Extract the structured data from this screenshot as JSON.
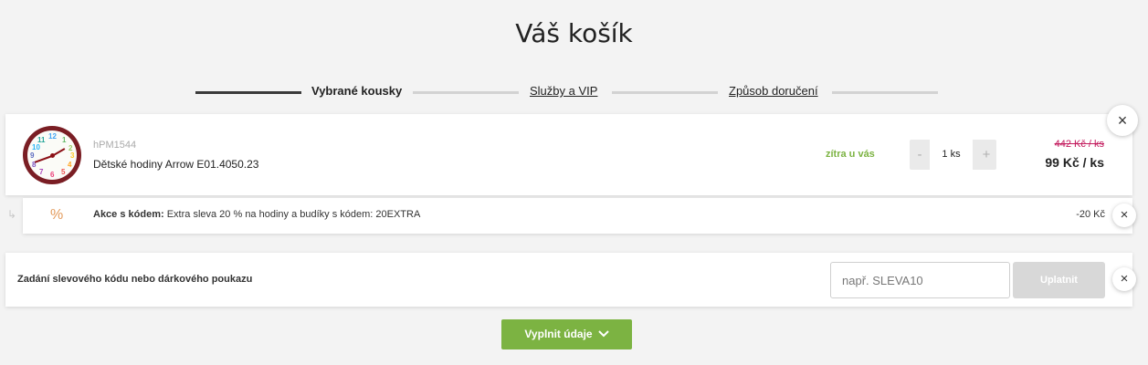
{
  "page": {
    "title": "Váš košík"
  },
  "steps": [
    {
      "label": "Vybrané kousky",
      "active": true
    },
    {
      "label": "Služby a VIP",
      "active": false
    },
    {
      "label": "Způsob doručení",
      "active": false
    }
  ],
  "product": {
    "sku": "hPM1544",
    "name": "Dětské hodiny Arrow E01.4050.23",
    "delivery": "zítra u vás",
    "quantity": "1 ks",
    "qty_minus": "-",
    "qty_plus": "+",
    "price_old": "442 Kč / ks",
    "price_new": "99 Kč / ks",
    "clock_numbers": [
      "12",
      "1",
      "2",
      "3",
      "4",
      "5",
      "6",
      "7",
      "8",
      "9",
      "10",
      "11"
    ]
  },
  "discount": {
    "icon": "%",
    "label": "Akce s kódem:",
    "text": "Extra sleva 20 % na hodiny a budíky s kódem: 20EXTRA",
    "amount": "-20 Kč"
  },
  "voucher": {
    "label": "Zadání slevového kódu nebo dárkového poukazu",
    "placeholder": "např. SLEVA10",
    "button": "Uplatnit"
  },
  "continue_button": {
    "label": "Vyplnit údaje"
  },
  "icons": {
    "close": "×",
    "sub_arrow": "↳",
    "chevron": "⌄"
  },
  "colors": {
    "accent_green": "#7cb342",
    "old_price": "#c2185b",
    "percent": "#e39b5d"
  }
}
